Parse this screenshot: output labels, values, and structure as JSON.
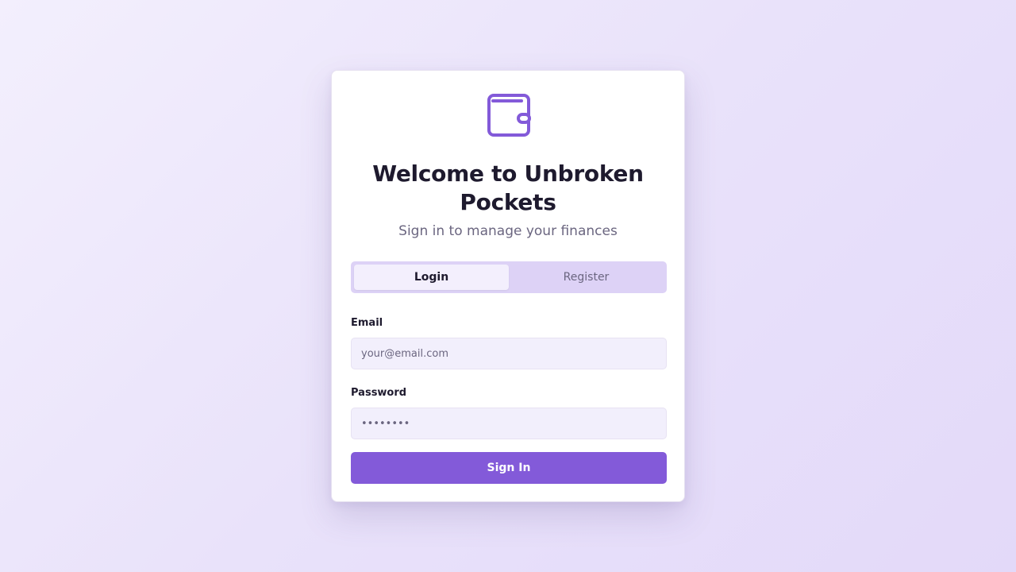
{
  "brand": {
    "logo_icon": "wallet-icon",
    "accent_color": "#835ad9",
    "title": "Welcome to Unbroken Pockets",
    "subtitle": "Sign in to manage your finances"
  },
  "tabs": [
    {
      "label": "Login",
      "active": true
    },
    {
      "label": "Register",
      "active": false
    }
  ],
  "form": {
    "email": {
      "label": "Email",
      "placeholder": "your@email.com",
      "value": ""
    },
    "password": {
      "label": "Password",
      "placeholder": "••••••••",
      "value": ""
    },
    "submit_label": "Sign In"
  }
}
